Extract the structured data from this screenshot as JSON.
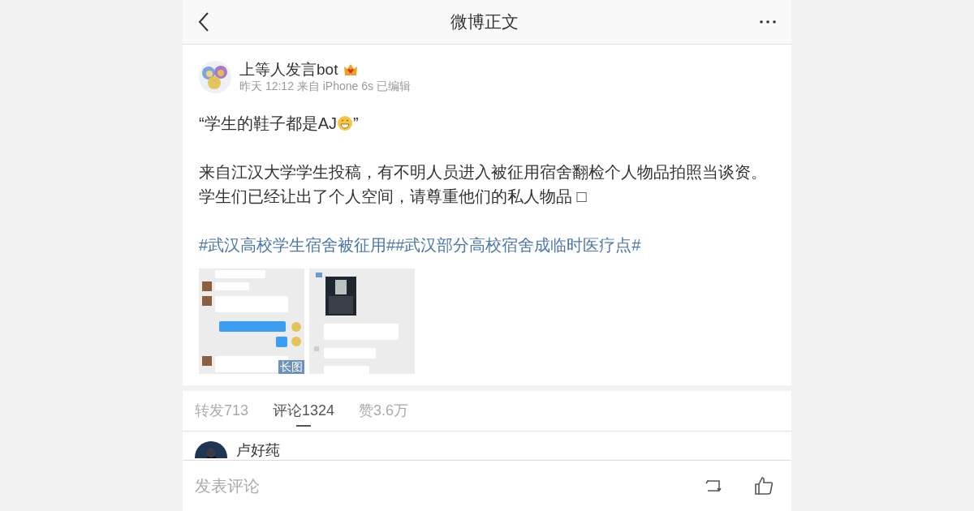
{
  "header": {
    "title": "微博正文"
  },
  "post": {
    "author": "上等人发言bot",
    "meta": "昨天 12:12 来自 iPhone 6s 已编辑",
    "quote_open": "“学生的鞋子都是AJ",
    "quote_close": "”",
    "paragraphs": [
      "来自江汉大学学生投稿，有不明人员进入被征用宿舍翻检个人物品拍照当谈资。",
      "学生们已经让出了个人空间，请尊重他们的私人物品 □"
    ],
    "hashtags": "#武汉高校学生宿舍被征用##武汉部分高校宿舍成临时医疗点#",
    "images": [
      {
        "kind": "picture",
        "badge": "长图"
      },
      {
        "kind": "picture"
      }
    ]
  },
  "tabs": [
    {
      "label": "转发713",
      "selected": false
    },
    {
      "label": "评论1324",
      "selected": true
    },
    {
      "label": "赞3.6万",
      "selected": false
    }
  ],
  "comments": [
    {
      "author": "卢好莼"
    }
  ],
  "bottom_bar": {
    "placeholder": "发表评论"
  }
}
